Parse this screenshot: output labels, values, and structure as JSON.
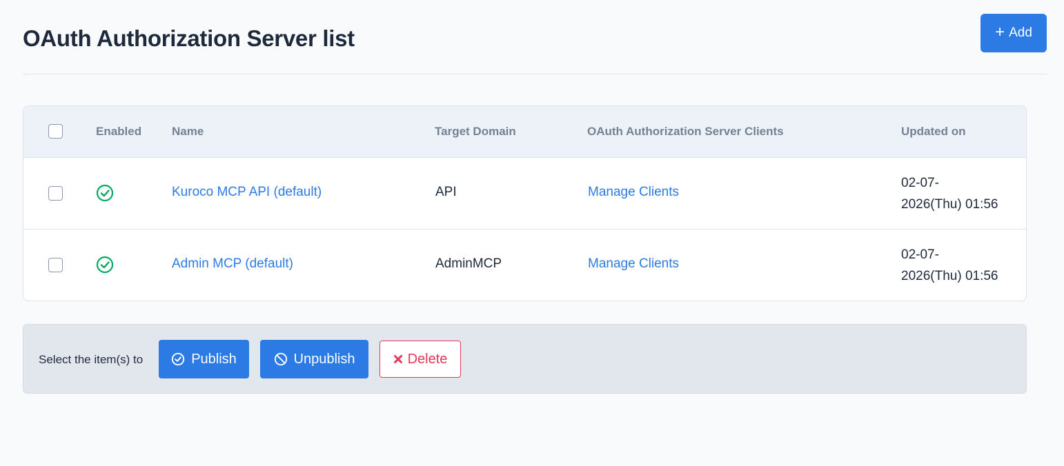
{
  "header": {
    "title": "OAuth Authorization Server list",
    "add_label": "Add"
  },
  "table": {
    "columns": {
      "enabled": "Enabled",
      "name": "Name",
      "target_domain": "Target Domain",
      "clients": "OAuth Authorization Server Clients",
      "updated_on": "Updated on"
    },
    "rows": [
      {
        "enabled": true,
        "name": "Kuroco MCP API (default)",
        "target_domain": "API",
        "clients_link": "Manage Clients",
        "updated_line1": "02-07-",
        "updated_line2": "2026(Thu) 01:56"
      },
      {
        "enabled": true,
        "name": "Admin MCP (default)",
        "target_domain": "AdminMCP",
        "clients_link": "Manage Clients",
        "updated_line1": "02-07-",
        "updated_line2": "2026(Thu) 01:56"
      }
    ]
  },
  "bulk_actions": {
    "label": "Select the item(s) to",
    "publish_label": "Publish",
    "unpublish_label": "Unpublish",
    "delete_label": "Delete"
  },
  "colors": {
    "primary": "#2c7be5",
    "success": "#00a862",
    "danger": "#e63757",
    "header_bg": "#edf2f9"
  },
  "icons": {
    "add": "plus-icon",
    "enabled": "check-circle-icon",
    "publish": "check-circle-icon",
    "unpublish": "ban-icon",
    "delete": "close-icon"
  }
}
